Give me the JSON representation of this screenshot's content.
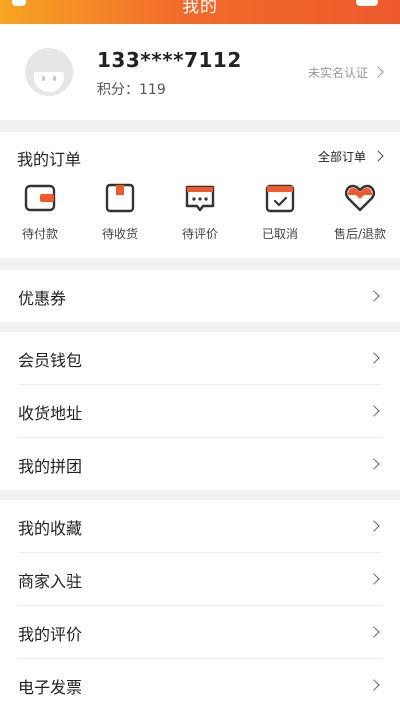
{
  "header": {
    "title": "我的"
  },
  "profile": {
    "phone": "133****7112",
    "points_label": "积分：119",
    "verify_label": "未实名认证"
  },
  "orders": {
    "heading": "我的订单",
    "all_label": "全部订单",
    "items": [
      {
        "label": "待付款",
        "icon": "wallet-icon"
      },
      {
        "label": "待收货",
        "icon": "package-icon"
      },
      {
        "label": "待评价",
        "icon": "comment-icon"
      },
      {
        "label": "已取消",
        "icon": "calendar-check-icon"
      },
      {
        "label": "售后/退款",
        "icon": "heart-icon"
      }
    ]
  },
  "menu": {
    "group1": [
      {
        "label": "优惠券"
      }
    ],
    "group2": [
      {
        "label": "会员钱包"
      },
      {
        "label": "收货地址"
      },
      {
        "label": "我的拼团"
      }
    ],
    "group3": [
      {
        "label": "我的收藏"
      },
      {
        "label": "商家入驻"
      },
      {
        "label": "我的评价"
      },
      {
        "label": "电子发票"
      }
    ]
  },
  "colors": {
    "accent": "#ee5a2c",
    "header_gradient_start": "#f6a623",
    "icon_dark": "#333333"
  }
}
